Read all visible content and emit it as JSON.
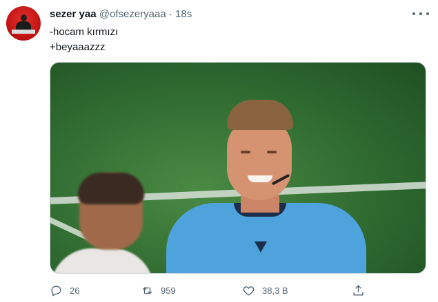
{
  "tweet": {
    "author_name": "sezer yaa",
    "author_handle": "@ofsezeryaaa",
    "separator": "·",
    "time": "18s",
    "text": "-hocam kırmızı\n+beyaaazzz"
  },
  "icons": {
    "more": "more-horizontal-icon",
    "reply": "reply-icon",
    "retweet": "retweet-icon",
    "like": "like-heart-icon",
    "share": "share-icon"
  },
  "actions": {
    "reply_count": "26",
    "retweet_count": "959",
    "like_count": "38,3 B"
  },
  "colors": {
    "text": "#0f1419",
    "muted": "#536471",
    "avatar_red": "#c41414",
    "referee_shirt": "#4ea3dc"
  }
}
